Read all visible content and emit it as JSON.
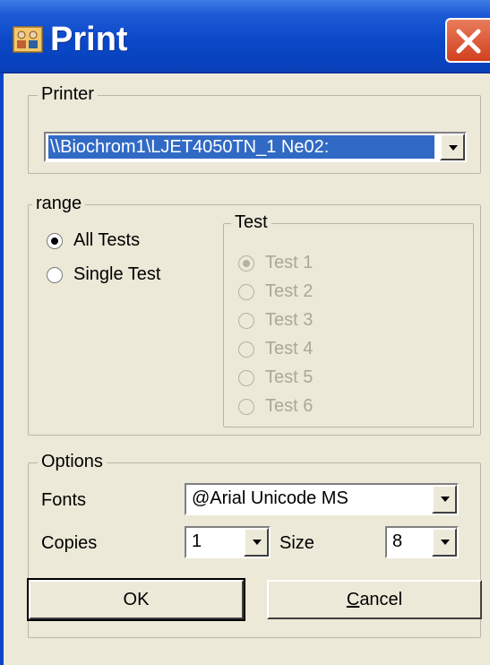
{
  "window": {
    "title": "Print",
    "icon": "printer-people-icon",
    "close_icon": "close-icon"
  },
  "printer": {
    "legend": "Printer",
    "selected": "\\\\Biochrom1\\LJET4050TN_1 Ne02:"
  },
  "range": {
    "legend": "range",
    "options": [
      {
        "label": "All Tests",
        "checked": true
      },
      {
        "label": "Single Test",
        "checked": false
      }
    ],
    "test": {
      "legend": "Test",
      "items": [
        {
          "label": "Test 1",
          "checked": true
        },
        {
          "label": "Test 2",
          "checked": false
        },
        {
          "label": "Test 3",
          "checked": false
        },
        {
          "label": "Test 4",
          "checked": false
        },
        {
          "label": "Test 5",
          "checked": false
        },
        {
          "label": "Test 6",
          "checked": false
        }
      ]
    }
  },
  "options": {
    "legend": "Options",
    "fonts_label": "Fonts",
    "fonts_value": "@Arial Unicode MS",
    "copies_label": "Copies",
    "copies_value": "1",
    "size_label": "Size",
    "size_value": "8"
  },
  "buttons": {
    "ok": "OK",
    "cancel": "Cancel"
  },
  "colors": {
    "titlebar": "#0a47c7",
    "dialog_bg": "#ece9d8",
    "selection": "#316ac5",
    "close": "#d2401e"
  }
}
